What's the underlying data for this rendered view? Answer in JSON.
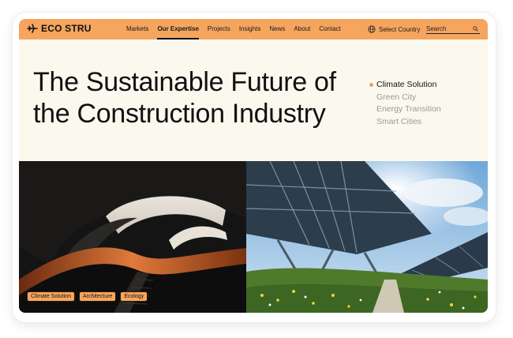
{
  "brand": {
    "name": "ECO STRU",
    "logo_icon": "plane-icon"
  },
  "nav": {
    "items": [
      {
        "label": "Markets",
        "active": false
      },
      {
        "label": "Our Expertise",
        "active": true
      },
      {
        "label": "Projects",
        "active": false
      },
      {
        "label": "Insights",
        "active": false
      },
      {
        "label": "News",
        "active": false
      },
      {
        "label": "About",
        "active": false
      },
      {
        "label": "Contact",
        "active": false
      }
    ],
    "country_label": "Select Country",
    "search_placeholder": "Search"
  },
  "hero": {
    "title_line1": "The Sustainable Future of",
    "title_line2": "the Construction Industry"
  },
  "topics": [
    {
      "label": "Climate Solution",
      "active": true
    },
    {
      "label": "Green City",
      "active": false
    },
    {
      "label": "Energy Transition",
      "active": false
    },
    {
      "label": "Smart Cities",
      "active": false
    }
  ],
  "tags": [
    "Climate Solution",
    "Architecture",
    "Ecology"
  ],
  "colors": {
    "accent": "#f6a55e",
    "background": "#fbf8ee"
  }
}
